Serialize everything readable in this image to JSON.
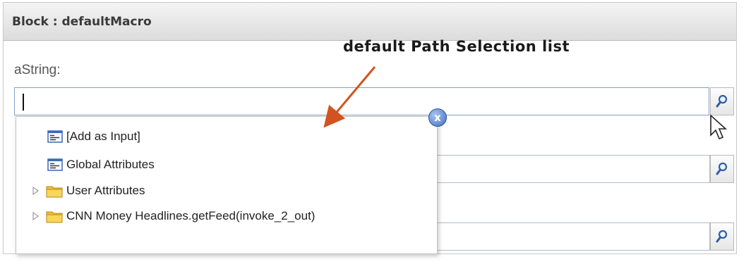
{
  "panel": {
    "title": "Block : defaultMacro"
  },
  "annotation": {
    "callout": "default Path Selection list"
  },
  "form": {
    "field_label": "aString:",
    "input_value": ""
  },
  "dropdown": {
    "close_label": "x",
    "items": [
      {
        "label": "[Add as Input]",
        "icon": "attribute-list-icon",
        "expandable": false
      },
      {
        "label": "Global Attributes",
        "icon": "attribute-list-icon",
        "expandable": false
      },
      {
        "label": "User Attributes",
        "icon": "folder-icon",
        "expandable": true
      },
      {
        "label": "CNN Money Headlines.getFeed(invoke_2_out)",
        "icon": "folder-icon",
        "expandable": true
      }
    ]
  },
  "colors": {
    "arrow": "#d2531f",
    "header": "#dcdcdc",
    "close_badge": "#3f6fbf",
    "folder": "#f2c230"
  }
}
